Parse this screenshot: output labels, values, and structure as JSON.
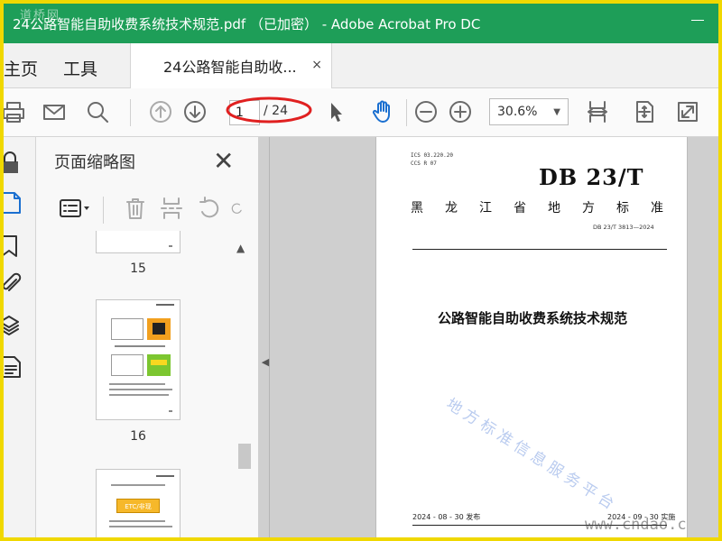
{
  "window": {
    "title": "24公路智能自助收费系统技术规范.pdf （已加密） - Adobe Acrobat Pro DC",
    "logo_text": "道桥网",
    "titlebar_color": "#1e9e58"
  },
  "menu": {
    "home_label": "主页",
    "tools_label": "工具"
  },
  "tab": {
    "label": "24公路智能自助收...",
    "close_glyph": "×"
  },
  "toolbar": {
    "icons": [
      "print-icon",
      "mail-icon",
      "search-icon",
      "page-up-icon",
      "page-down-icon",
      "select-arrow-icon",
      "hand-tool-icon",
      "zoom-out-icon",
      "zoom-in-icon",
      "fit-width-icon",
      "fit-page-icon",
      "full-screen-icon"
    ],
    "current_page": "1",
    "total_pages": "/ 24",
    "zoom_value": "30.6%",
    "annotation_color": "#e02020"
  },
  "rail": {
    "icons": [
      "lock-icon",
      "pages-icon",
      "bookmark-icon",
      "attachment-icon",
      "layers-icon",
      "document-icon"
    ]
  },
  "thumbnails_panel": {
    "title": "页面缩略图",
    "close_glyph": "✕",
    "tools": [
      "options-menu-icon",
      "delete-icon",
      "insert-icon",
      "undo-icon",
      "redo-icon"
    ],
    "pages": [
      {
        "label": "15"
      },
      {
        "label": "16"
      },
      {
        "label": "",
        "badge": "ETC/非现"
      }
    ]
  },
  "document": {
    "ics_line1": "ICS  03.220.20",
    "ics_line2": "CCS  R 07",
    "db_mark": "DB 23/T",
    "province_chars": [
      "黑",
      "龙",
      "江",
      "省",
      "地",
      "方",
      "标",
      "准"
    ],
    "doc_number": "DB 23/T  3813—2024",
    "title": "公路智能自助收费系统技术规范",
    "publish": "2024 - 08 - 30 发布",
    "implement": "2024 - 09 - 30 实施"
  },
  "watermarks": {
    "stamp_text": "地方标准信息服务平台",
    "url_text": "www.cndao.c"
  }
}
